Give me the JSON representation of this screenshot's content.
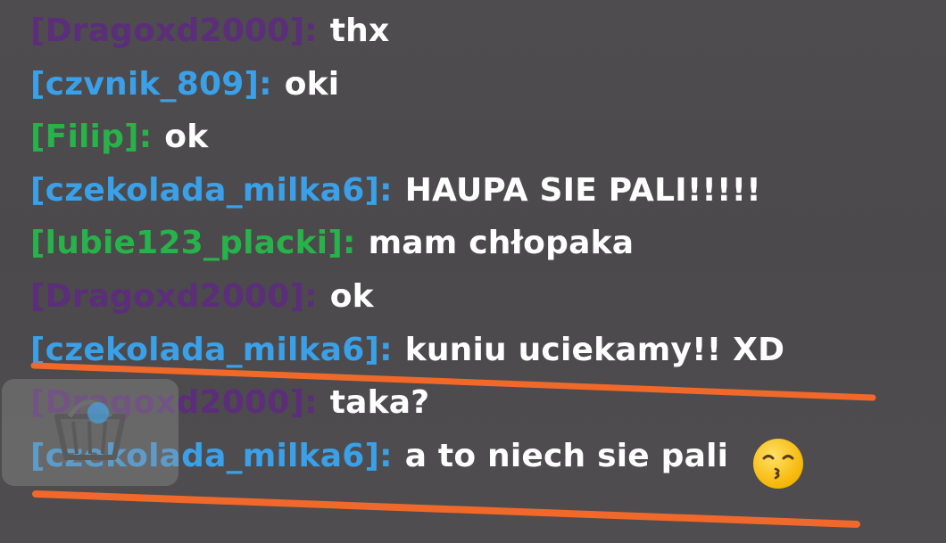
{
  "chat": {
    "messages": [
      {
        "speaker": "[Dragoxd2000]",
        "separator": ":",
        "text": "thx",
        "color": "#5b2d7a"
      },
      {
        "speaker": "[czvnik_809]",
        "separator": ":",
        "text": "oki",
        "color": "#3aa0e8"
      },
      {
        "speaker": "[Filip]",
        "separator": ":",
        "text": "ok",
        "color": "#27b24a"
      },
      {
        "speaker": "[czekolada_milka6]",
        "separator": ":",
        "text": "HAUPA SIE PALI!!!!!",
        "color": "#3aa0e8"
      },
      {
        "speaker": "[lubie123_placki]",
        "separator": ":",
        "text": "mam chłopaka",
        "color": "#27b24a"
      },
      {
        "speaker": "[Dragoxd2000]",
        "separator": ":",
        "text": "ok",
        "color": "#5b2d7a"
      },
      {
        "speaker": "[czekolada_milka6]",
        "separator": ":",
        "text": "kuniu uciekamy!! XD",
        "color": "#3aa0e8"
      },
      {
        "speaker": "[Dragoxd2000]",
        "separator": ":",
        "text": "taka?",
        "color": "#5b2d7a"
      },
      {
        "speaker": "[czekolada_milka6]",
        "separator": ":",
        "text": "a to niech sie pali",
        "color": "#3aa0e8"
      }
    ]
  },
  "colors": {
    "annotation_underline": "#f0692a",
    "message_text": "#ffffff"
  },
  "icons": {
    "backpack_button": "basket-icon",
    "emoji": "kissing-face-emoji"
  }
}
